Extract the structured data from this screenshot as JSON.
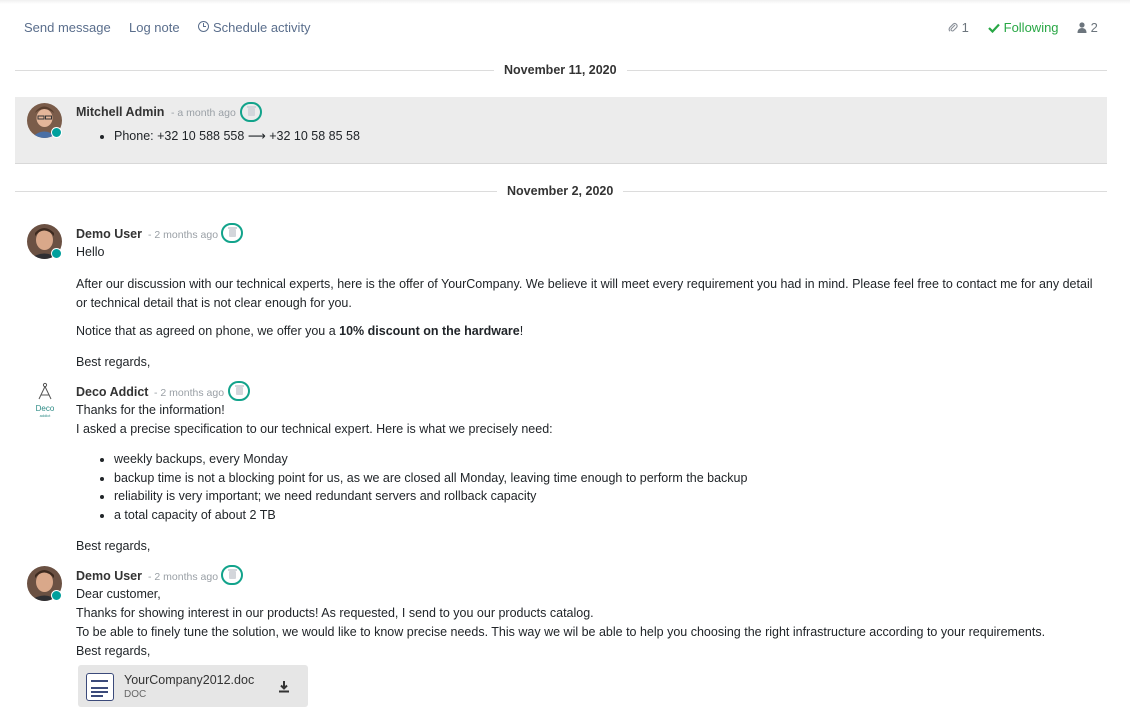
{
  "actions": {
    "send_message": "Send message",
    "log_note": "Log note",
    "schedule_activity": "Schedule activity"
  },
  "topright": {
    "attachments_count": "1",
    "following_label": "Following",
    "followers_count": "2"
  },
  "dates": {
    "first": "November 11, 2020",
    "second": "November 2, 2020"
  },
  "messages": [
    {
      "author": "Mitchell Admin",
      "when": "- a month ago",
      "tracking": "Phone: +32 10 588 558 ⟶ +32 10 58 85 58"
    },
    {
      "author": "Demo User",
      "when": "- 2 months ago",
      "greeting": "Hello",
      "p1": "After our discussion with our technical experts, here is the offer of YourCompany. We believe it will meet every requirement you had in mind. Please feel free to contact me for any detail or technical detail that is not clear enough for you.",
      "p2_prefix": "Notice that as agreed on phone, we offer you a ",
      "p2_bold": "10% discount on the hardware",
      "p2_suffix": "!",
      "closing": "Best regards,"
    },
    {
      "author": "Deco Addict",
      "when": "- 2 months ago",
      "logo_text": "Deco",
      "logo_subtext": "addict",
      "line1": "Thanks for the information!",
      "line2": "I asked a precise specification to our technical expert. Here is what we precisely need:",
      "bullets": [
        "weekly backups, every Monday",
        "backup time is not a blocking point for us, as we are closed all Monday, leaving time enough to perform the backup",
        "reliability is very important; we need redundant servers and rollback capacity",
        "a total capacity of about 2 TB"
      ],
      "closing": "Best regards,"
    },
    {
      "author": "Demo User",
      "when": "- 2 months ago",
      "line1": "Dear customer,",
      "line2": "Thanks for showing interest in our products! As requested, I send to you our products catalog.",
      "line3": "To be able to finely tune the solution, we would like to know precise needs. This way we wil be able to help you choosing the right infrastructure according to your requirements.",
      "line4": "Best regards,",
      "attachment": {
        "name": "YourCompany2012.doc",
        "type": "DOC"
      }
    }
  ]
}
